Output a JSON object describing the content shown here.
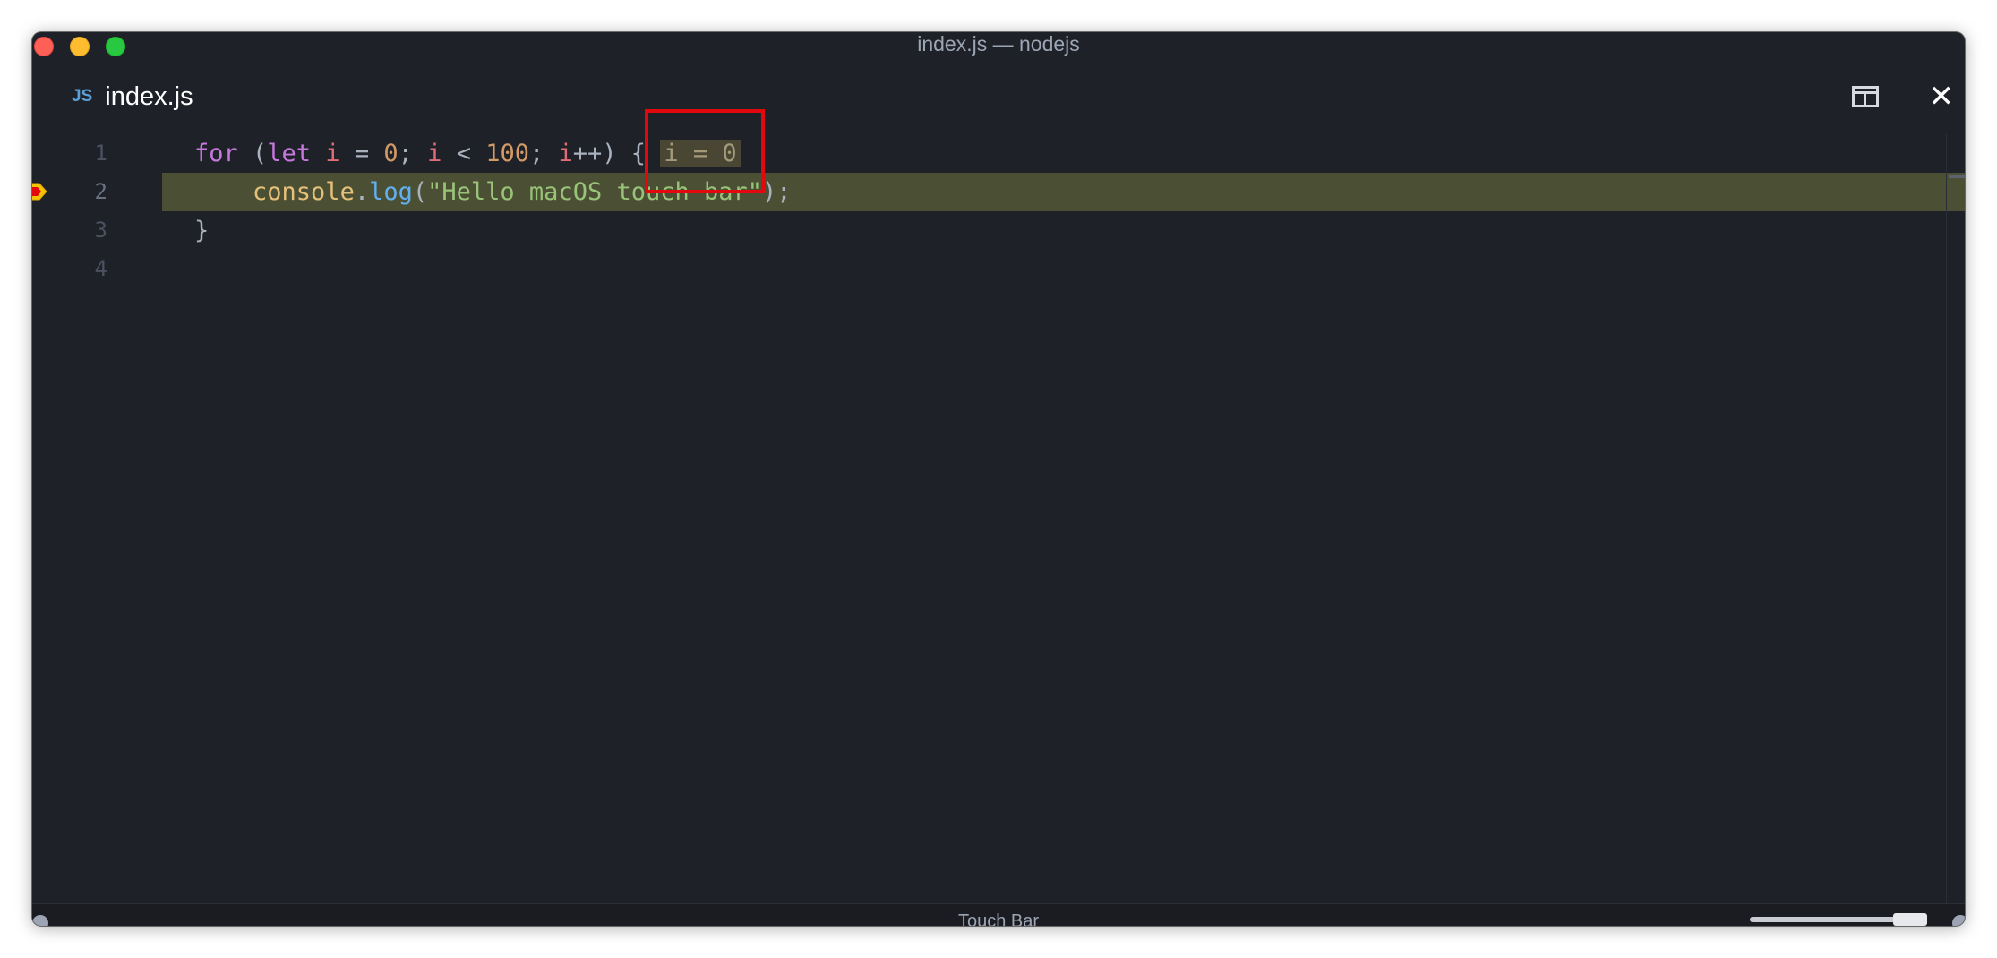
{
  "window": {
    "title": "index.js — nodejs"
  },
  "tab": {
    "icon_label": "JS",
    "label": "index.js"
  },
  "editor": {
    "lines": [
      {
        "number": "1"
      },
      {
        "number": "2"
      },
      {
        "number": "3"
      },
      {
        "number": "4"
      }
    ],
    "line1": {
      "for": "for",
      "open": " (",
      "let": "let",
      "sp1": " ",
      "i1": "i",
      "eq": " = ",
      "zero": "0",
      "semi1": "; ",
      "i2": "i",
      "lt": " < ",
      "hundred": "100",
      "semi2": "; ",
      "i3": "i",
      "inc": "++) { ",
      "inline_value": "i = 0"
    },
    "line2": {
      "indent": "    ",
      "console": "console",
      "dot": ".",
      "log": "log",
      "open": "(",
      "string": "\"Hello macOS touch bar\"",
      "close": ");"
    },
    "line3": {
      "brace": "}"
    },
    "current_line": 2,
    "breakpoint_color": "#f5c400"
  },
  "statusbar": {
    "center_label": "Touch Bar"
  },
  "annotation": {
    "highlight_color": "#e3070e"
  }
}
